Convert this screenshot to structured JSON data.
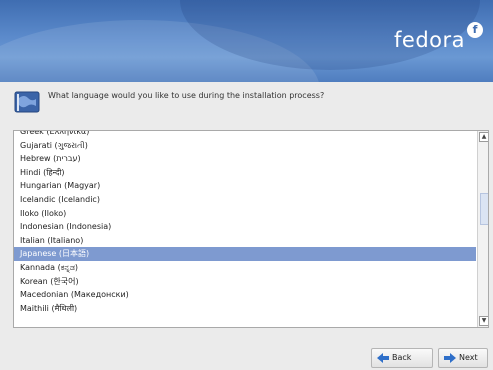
{
  "brand": {
    "name": "fedora",
    "mark": "f"
  },
  "prompt": {
    "text": "What language would you like to use during the installation process?"
  },
  "languages": [
    {
      "label": "Greek (Ελληνικά)",
      "selected": false
    },
    {
      "label": "Gujarati (ગુજરાતી)",
      "selected": false
    },
    {
      "label": "Hebrew (עברית)",
      "selected": false
    },
    {
      "label": "Hindi (हिन्दी)",
      "selected": false
    },
    {
      "label": "Hungarian (Magyar)",
      "selected": false
    },
    {
      "label": "Icelandic (Icelandic)",
      "selected": false
    },
    {
      "label": "Iloko (Iloko)",
      "selected": false
    },
    {
      "label": "Indonesian (Indonesia)",
      "selected": false
    },
    {
      "label": "Italian (Italiano)",
      "selected": false
    },
    {
      "label": "Japanese (日本語)",
      "selected": true
    },
    {
      "label": "Kannada (ಕನ್ನಡ)",
      "selected": false
    },
    {
      "label": "Korean (한국어)",
      "selected": false
    },
    {
      "label": "Macedonian (Македонски)",
      "selected": false
    },
    {
      "label": "Maithili (मैथिली)",
      "selected": false
    }
  ],
  "buttons": {
    "back": "Back",
    "next": "Next"
  },
  "colors": {
    "banner": "#4f7dbf",
    "selection": "#7e9ad0",
    "icon_blue": "#2f6fc9"
  }
}
